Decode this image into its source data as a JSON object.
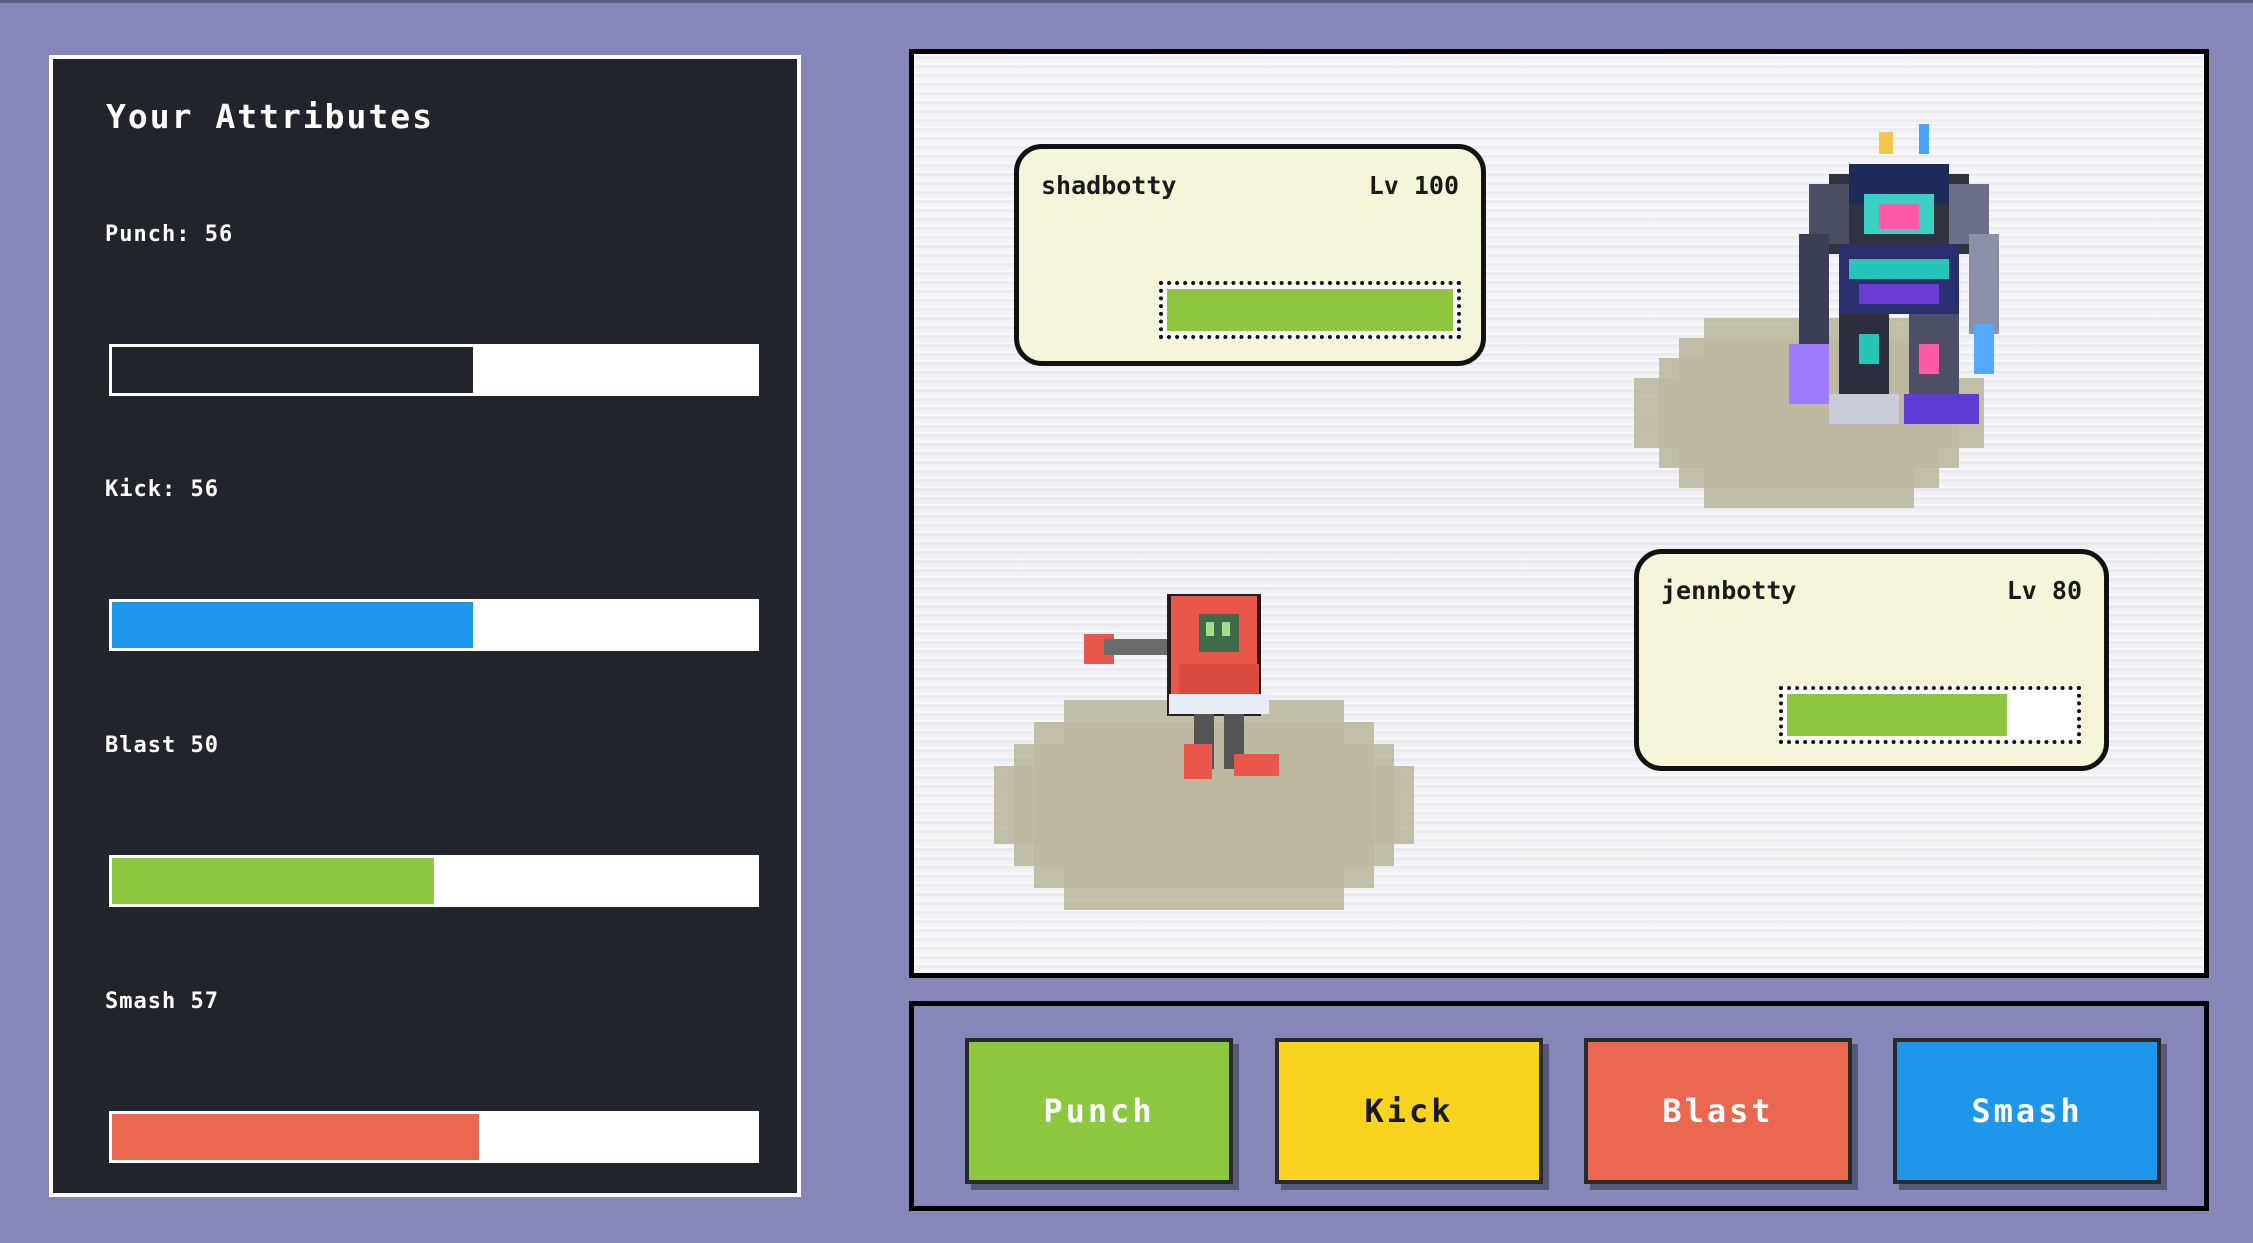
{
  "attributes": {
    "title": "Your Attributes",
    "items": [
      {
        "label": "Punch: 56",
        "value": 56,
        "color": "#21242a"
      },
      {
        "label": "Kick: 56",
        "value": 56,
        "color": "#1e97ea"
      },
      {
        "label": "Blast 50",
        "value": 50,
        "color": "#8dc63f"
      },
      {
        "label": "Smash 57",
        "value": 57,
        "color": "#e9684f"
      }
    ]
  },
  "battle": {
    "opponent": {
      "name": "shadbotty",
      "level": "Lv 100",
      "hp_fraction": 1.0
    },
    "player": {
      "name": "jennbotty",
      "level": "Lv 80",
      "hp_fraction": 0.77
    },
    "hp_color": "#8ec63f"
  },
  "actions": [
    {
      "label": "Punch",
      "color": "#8dc63f"
    },
    {
      "label": "Kick",
      "color": "#f8d31f"
    },
    {
      "label": "Blast",
      "color": "#e9684f"
    },
    {
      "label": "Smash",
      "color": "#1e97ea"
    }
  ]
}
